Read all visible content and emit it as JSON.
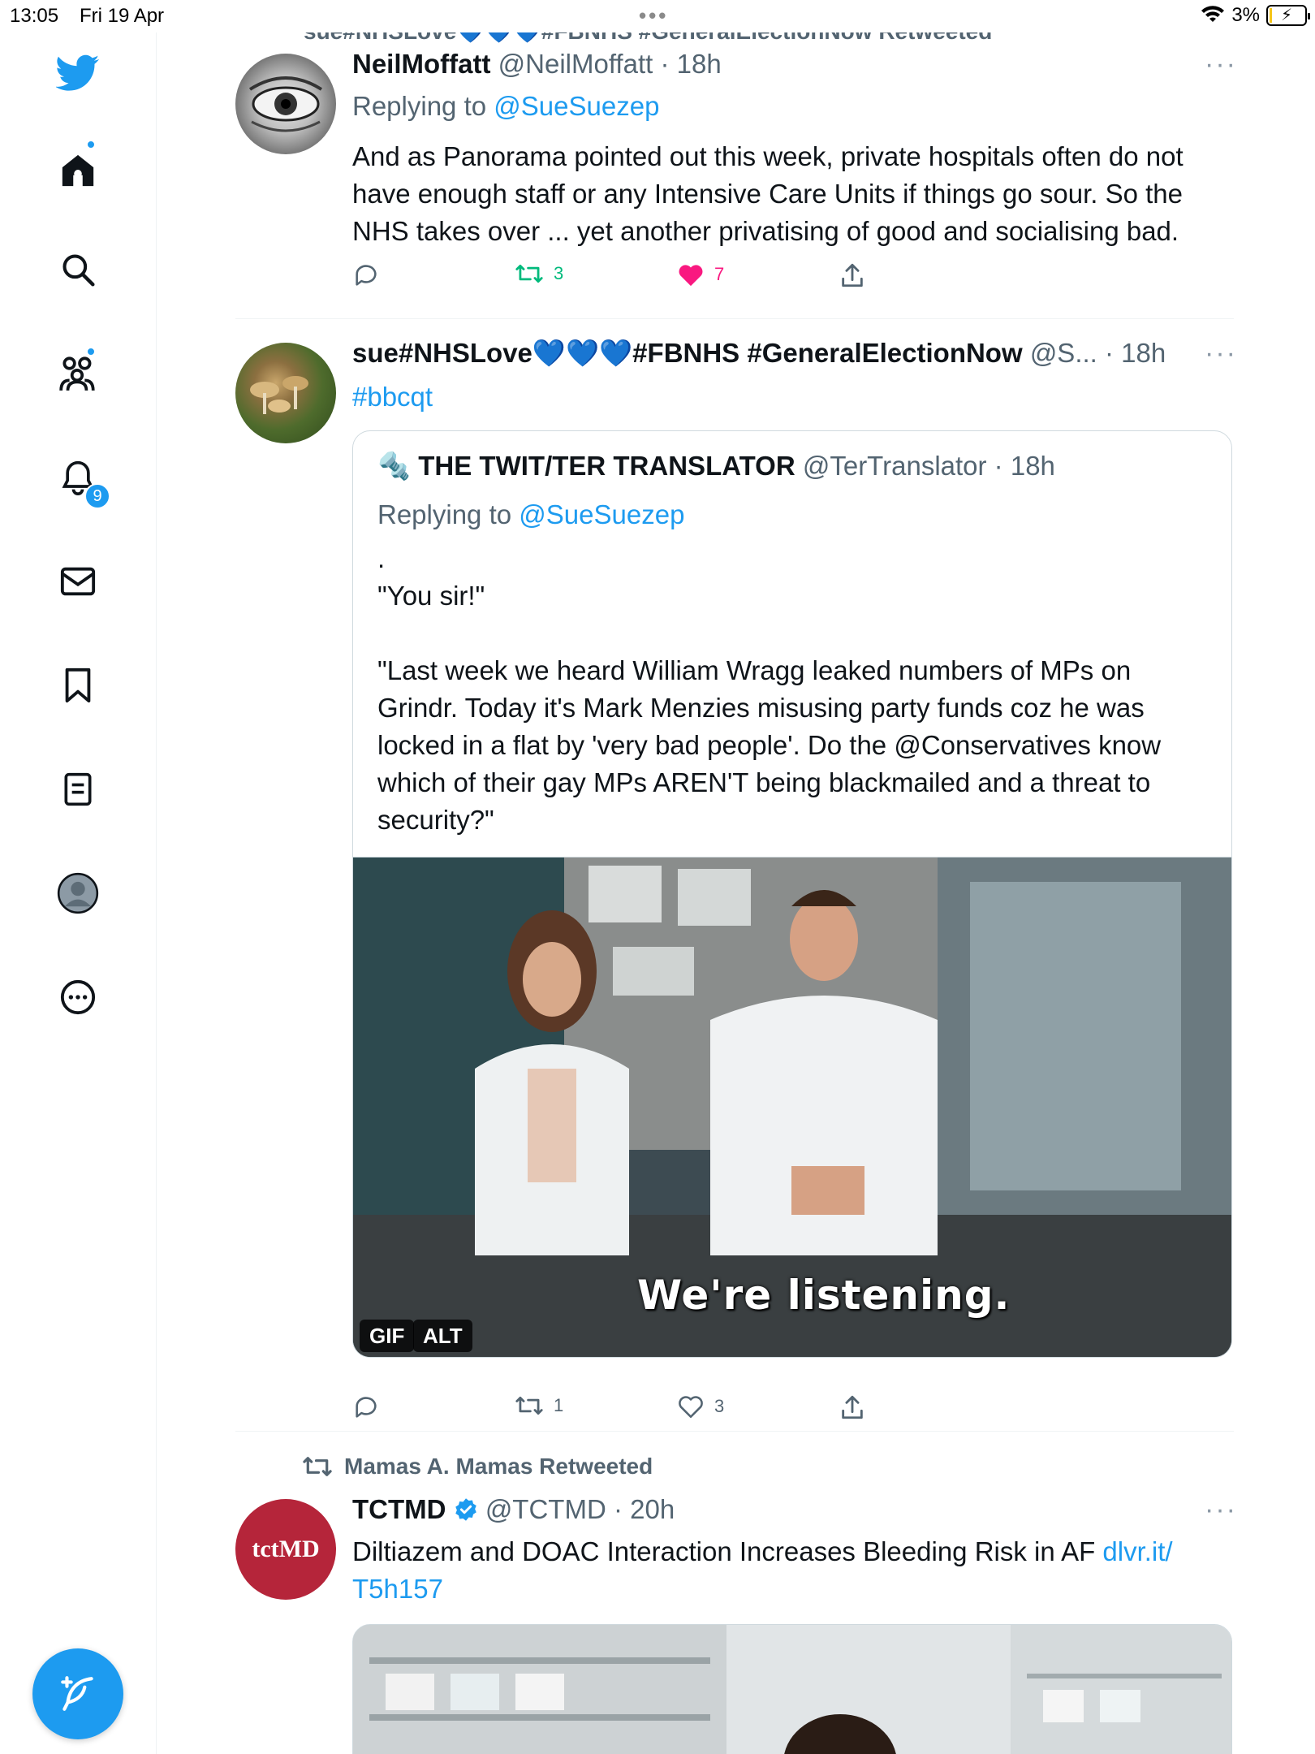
{
  "status_bar": {
    "time": "13:05",
    "date": "Fri 19 Apr",
    "battery": "3%"
  },
  "sidebar": {
    "notifications_count": "9"
  },
  "feed": {
    "top_retweet_label": "sue#NHSLove💙💙💙#FBNHS #GeneralElectionNow Retweeted",
    "tweets": [
      {
        "name": "NeilMoffatt",
        "handle": "@NeilMoffatt",
        "time": "18h",
        "replying_prefix": "Replying to",
        "replying_to": "@SueSuezep",
        "text_lines": [
          "And as Panorama pointed out this week, private hospitals often do not",
          "have enough staff or any Intensive Care Units if things go sour. So the",
          "NHS takes over ... yet another privatising of good and socialising bad."
        ],
        "retweets": "3",
        "likes": "7"
      },
      {
        "name": "sue#NHSLove💙💙💙#FBNHS #GeneralElectionNow",
        "handle": "@S...",
        "time": "18h",
        "text": "#bbcqt",
        "quote": {
          "prefix_emoji": "🔩",
          "name": "THE TWIT/TER TRANSLATOR",
          "handle": "@TerTranslator",
          "time": "18h",
          "replying_prefix": "Replying to",
          "replying_to": "@SueSuezep",
          "line_dot": ".",
          "line_you_sir": "\"You sir!\"",
          "body_lines": [
            "\"Last week we heard William Wragg leaked numbers of MPs on",
            "Grindr. Today it's Mark Menzies misusing party funds coz he was",
            "locked in a flat by 'very bad people'. Do the @Conservatives know",
            "which of their gay MPs AREN'T being blackmailed and a threat to",
            "security?\""
          ],
          "gif_caption": "We're listening.",
          "gif_badge": "GIF",
          "alt_badge": "ALT"
        },
        "retweets": "1",
        "likes": "3"
      },
      {
        "retweeted_by": "Mamas A. Mamas Retweeted",
        "avatar_text": "tctMD",
        "name": "TCTMD",
        "handle": "@TCTMD",
        "time": "20h",
        "text": "Diltiazem and DOAC Interaction Increases Bleeding Risk in AF",
        "link_part1": "dlvr.it/",
        "link_part2": "T5h157"
      }
    ]
  },
  "colors": {
    "accent": "#1d9bf0",
    "like": "#f91880",
    "retweet": "#00ba7c",
    "muted": "#536471"
  }
}
